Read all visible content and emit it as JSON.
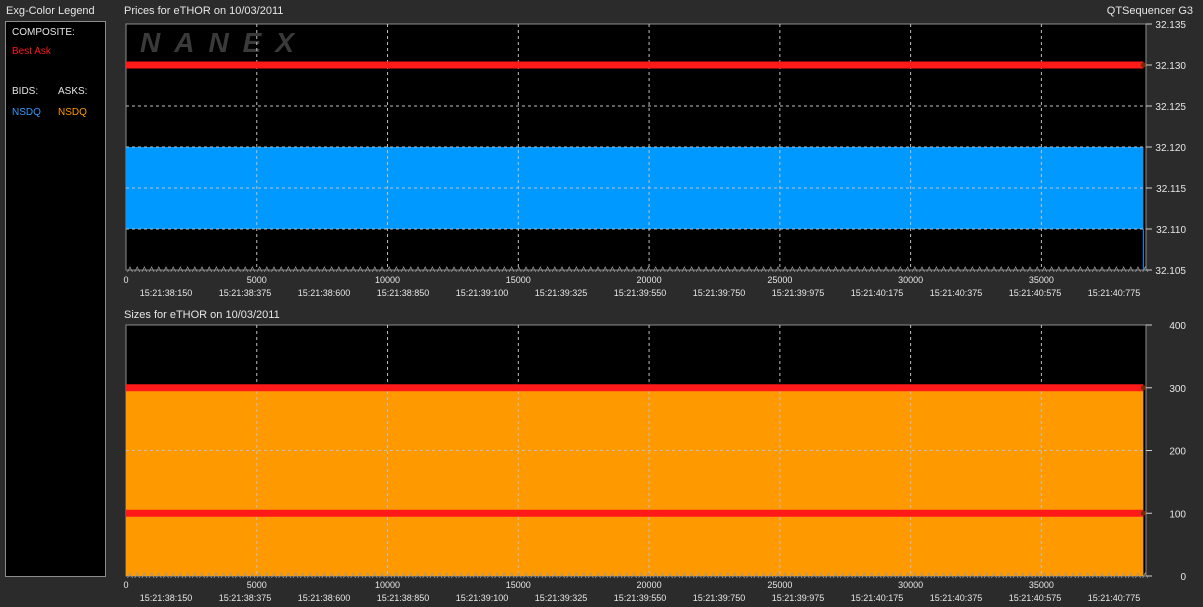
{
  "legend": {
    "title": "Exg-Color Legend",
    "composite_label": "COMPOSITE:",
    "best_ask_label": "Best Ask",
    "bids_label": "BIDS:",
    "asks_label": "ASKS:",
    "bid_exchange": "NSDQ",
    "ask_exchange": "NSDQ"
  },
  "app_name": "QTSequencer G3",
  "watermark": "NANEX",
  "colors": {
    "best_ask": "#ff1a1a",
    "bids": "#3399ff",
    "asks": "#ff9a00",
    "bid_fill": "#0099ff",
    "ask_size_fill": "#ff9900",
    "background": "#000000"
  },
  "chart_data": [
    {
      "type": "area",
      "title": "Prices for  eTHOR  on  10/03/2011",
      "x_ticks": [
        "0",
        "5000",
        "10000",
        "15000",
        "20000",
        "25000",
        "30000",
        "35000"
      ],
      "time_labels": [
        "15:21:38:150",
        "15:21:38:375",
        "15:21:38:600",
        "15:21:38:850",
        "15:21:39:100",
        "15:21:39:325",
        "15:21:39:550",
        "15:21:39:750",
        "15:21:39:975",
        "15:21:40:175",
        "15:21:40:375",
        "15:21:40:575",
        "15:21:40:775"
      ],
      "xlim": [
        0,
        39000
      ],
      "ylim": [
        32.105,
        32.135
      ],
      "y_ticks": [
        "32.135",
        "32.130",
        "32.125",
        "32.120",
        "32.115",
        "32.110",
        "32.105"
      ],
      "series": [
        {
          "name": "Best Ask",
          "kind": "line",
          "x": [
            0,
            38900
          ],
          "y": [
            32.13,
            32.13
          ]
        },
        {
          "name": "NSDQ",
          "kind": "band",
          "x": [
            0,
            38900
          ],
          "low": 32.11,
          "high": 32.12
        }
      ],
      "grid": true
    },
    {
      "type": "area",
      "title": "Sizes for  eTHOR  on  10/03/2011",
      "x_ticks": [
        "0",
        "5000",
        "10000",
        "15000",
        "20000",
        "25000",
        "30000",
        "35000"
      ],
      "time_labels": [
        "15:21:38:150",
        "15:21:38:375",
        "15:21:38:600",
        "15:21:38:850",
        "15:21:39:100",
        "15:21:39:325",
        "15:21:39:550",
        "15:21:39:750",
        "15:21:39:975",
        "15:21:40:175",
        "15:21:40:375",
        "15:21:40:575",
        "15:21:40:775"
      ],
      "xlim": [
        0,
        39000
      ],
      "ylim": [
        0,
        400
      ],
      "y_ticks": [
        "400",
        "300",
        "200",
        "100",
        "0"
      ],
      "series": [
        {
          "name": "NSDQ",
          "kind": "fill",
          "x": [
            0,
            38900
          ],
          "y": [
            300,
            300
          ]
        },
        {
          "kind": "line",
          "x": [
            0,
            38900
          ],
          "y": [
            300,
            300
          ]
        },
        {
          "kind": "line",
          "x": [
            0,
            38900
          ],
          "y": [
            100,
            100
          ]
        }
      ],
      "grid": true
    }
  ]
}
